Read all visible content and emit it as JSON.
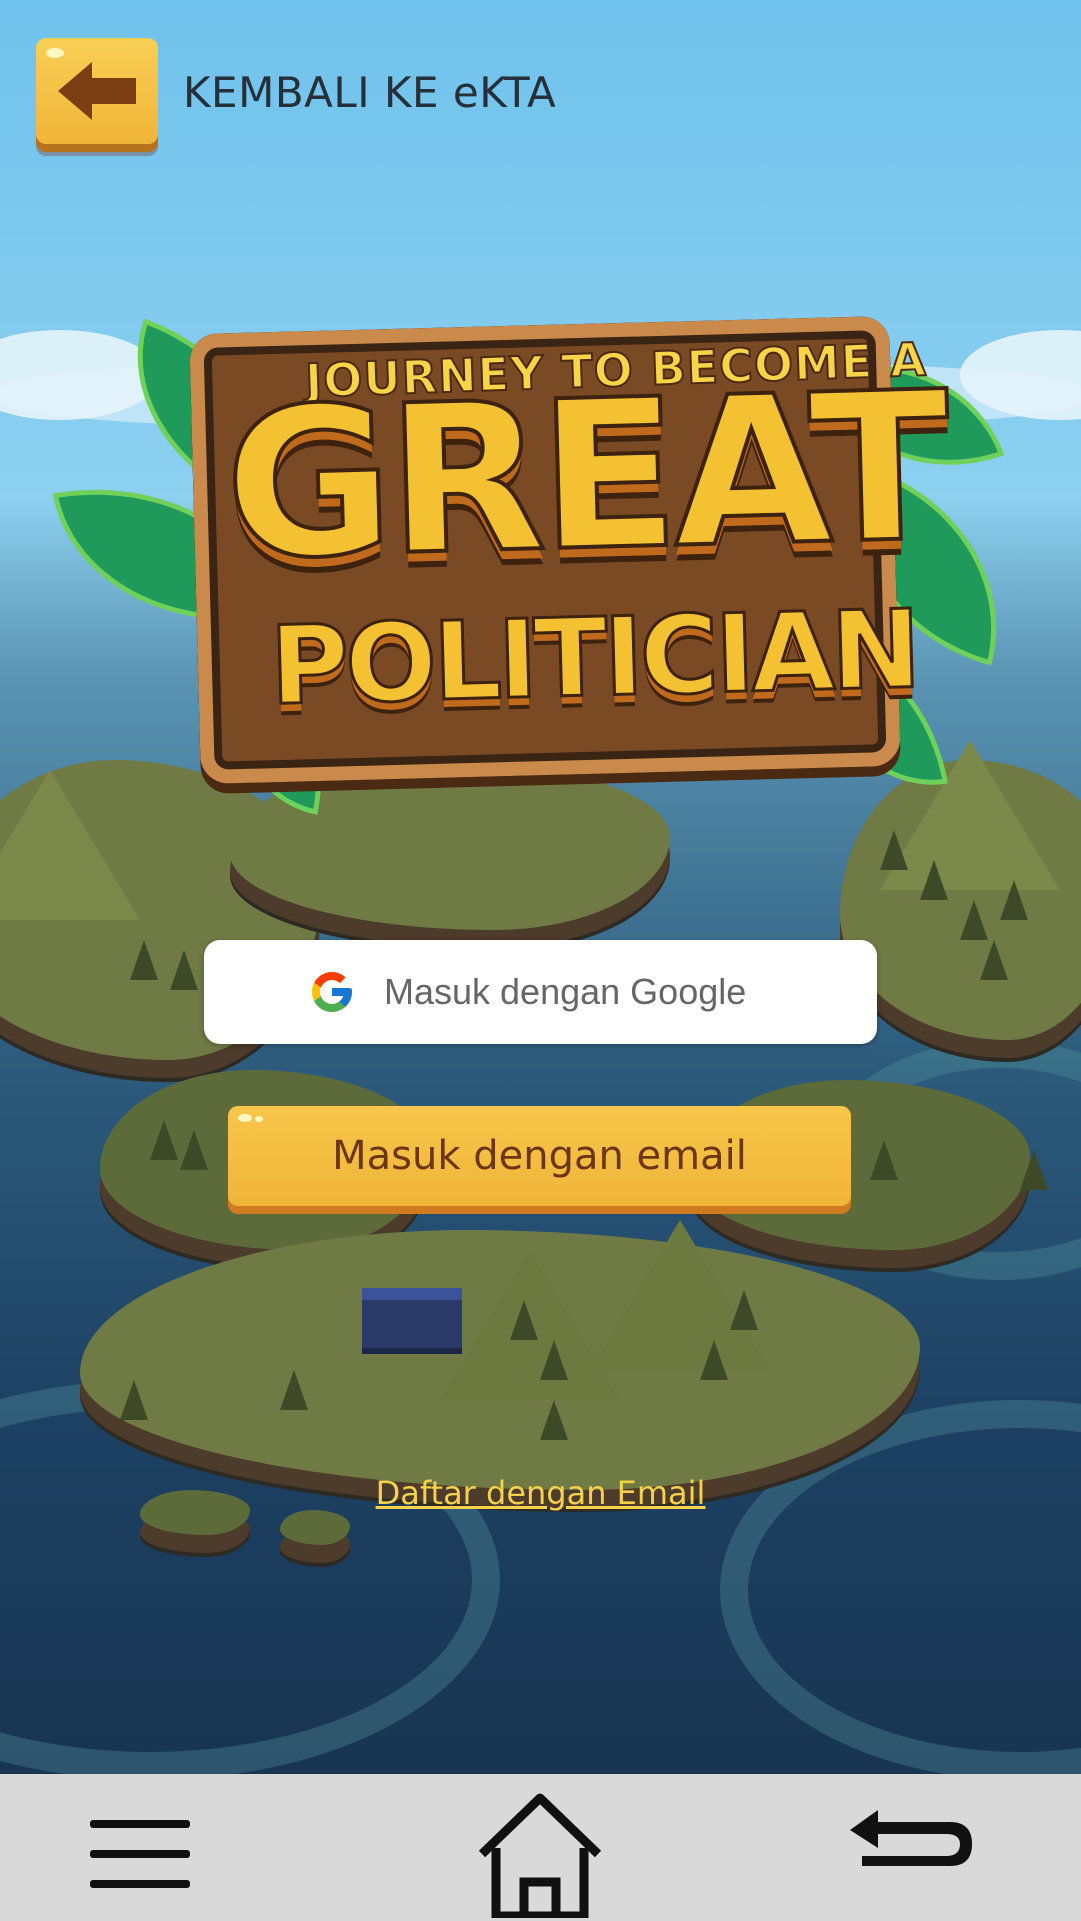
{
  "header": {
    "back_title": "KEMBALI KE eKTA",
    "back_icon": "arrow-left-icon"
  },
  "logo": {
    "top_line": "JOURNEY TO BECOME A",
    "main_word": "GREAT",
    "sub_word": "POLITICIAN"
  },
  "login": {
    "google_label": "Masuk dengan Google",
    "google_icon": "google-g-icon",
    "email_label": "Masuk dengan email",
    "register_link": "Daftar dengan Email"
  },
  "navbar": {
    "menu_icon": "hamburger-menu-icon",
    "home_icon": "home-icon",
    "back_icon": "back-return-icon"
  },
  "colors": {
    "accent_yellow": "#f0b53a",
    "button_text_brown": "#6b3613",
    "link_yellow": "#f5d24a",
    "navbar_bg": "#d9d9d9"
  }
}
